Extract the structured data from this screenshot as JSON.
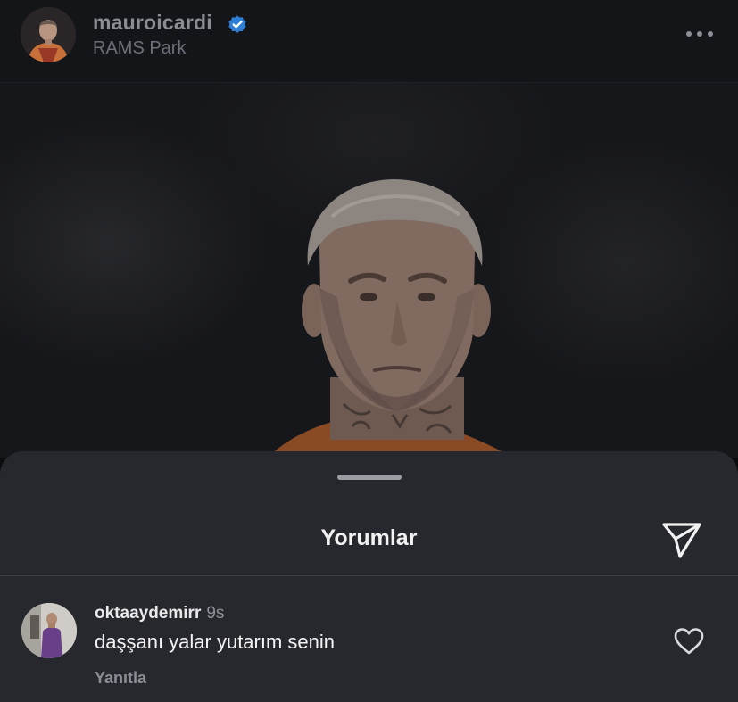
{
  "post": {
    "username": "mauroicardi",
    "location": "RAMS Park",
    "icons": {
      "verified": "verified-badge-icon",
      "more": "more-options-icon"
    },
    "colors": {
      "verified": "#3897f0",
      "jersey": "#c8703a"
    }
  },
  "comments_sheet": {
    "title": "Yorumlar",
    "send_icon": "send-icon",
    "comments": [
      {
        "username": "oktaaydemirr",
        "time": "9s",
        "text": "daşşanı yalar yutarım senin",
        "reply_label": "Yanıtla",
        "like_icon": "heart-outline-icon"
      }
    ]
  },
  "colors": {
    "sheet_background": "#26282d",
    "header_background": "#131519",
    "text_primary": "#f4f4f5",
    "text_secondary": "#8b8e95"
  }
}
